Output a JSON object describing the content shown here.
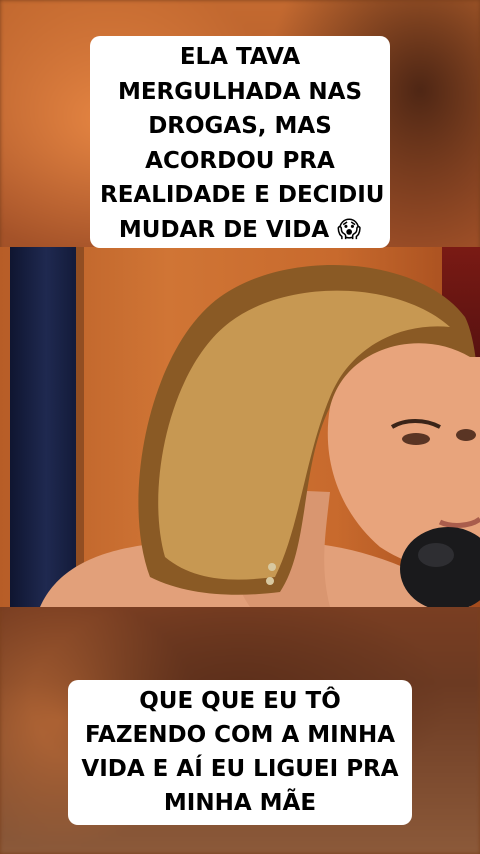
{
  "caption_top": {
    "lines": [
      "ELA TAVA",
      "MERGULHADA NAS",
      "DROGAS, MAS",
      "ACORDOU PRA",
      "REALIDADE E DECIDIU",
      "MUDAR DE VIDA 😱"
    ]
  },
  "caption_bottom": {
    "lines": [
      "QUE QUE EU TÔ",
      "FAZENDO COM A MINHA",
      "VIDA E AÍ EU LIGUEI PRA",
      "MINHA MÃE"
    ]
  },
  "icons": {
    "top_caption_emoji": "face-screaming-in-fear-icon"
  },
  "colors": {
    "caption_bg": "#ffffff",
    "caption_text": "#000000",
    "backdrop": "#c46a30"
  }
}
